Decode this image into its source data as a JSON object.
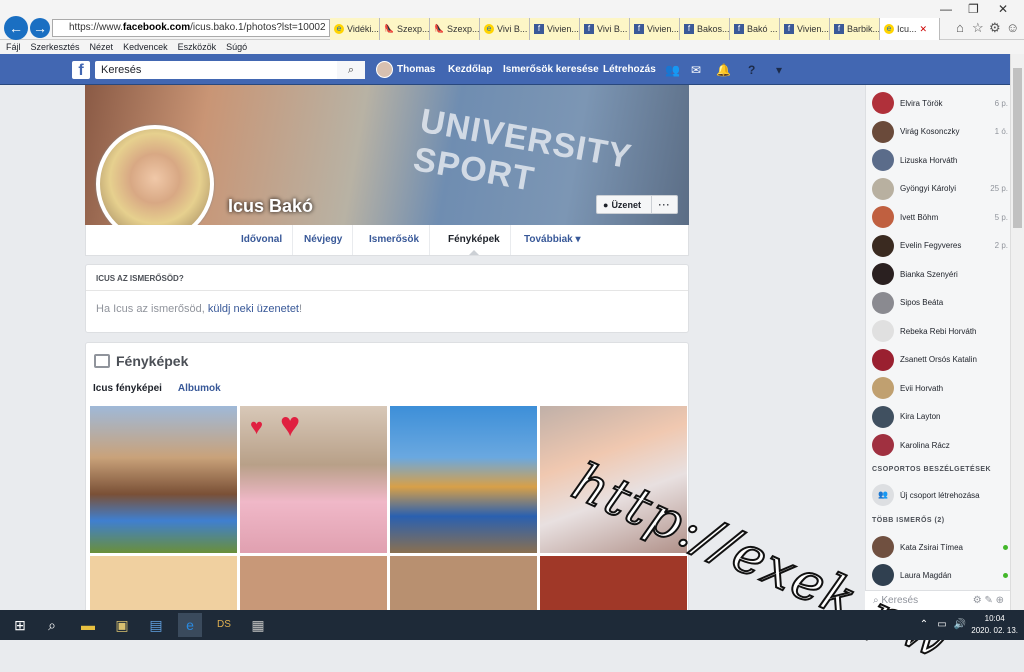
{
  "browser": {
    "url_prefix": "https://www.",
    "url_host": "facebook.com",
    "url_rest": "/icus.bako.1/photos?lst=10002",
    "tabs": [
      {
        "icon": "ie",
        "label": "Vidéki..."
      },
      {
        "icon": "shoe",
        "label": "Szexp..."
      },
      {
        "icon": "shoe",
        "label": "Szexp..."
      },
      {
        "icon": "ie",
        "label": "Vivi B..."
      },
      {
        "icon": "fb",
        "label": "Vivien..."
      },
      {
        "icon": "fb",
        "label": "Vivi B..."
      },
      {
        "icon": "fb",
        "label": "Vivien..."
      },
      {
        "icon": "fb",
        "label": "Bakos..."
      },
      {
        "icon": "fb",
        "label": "Bakó ..."
      },
      {
        "icon": "fb",
        "label": "Vivien..."
      },
      {
        "icon": "fb",
        "label": "Barbik..."
      },
      {
        "icon": "ie",
        "label": "Icu..."
      }
    ],
    "menu": [
      "Fájl",
      "Szerkesztés",
      "Nézet",
      "Kedvencek",
      "Eszközök",
      "Súgó"
    ]
  },
  "fb": {
    "search_placeholder": "Keresés",
    "user": "Thomas",
    "nav": [
      "Kezdőlap",
      "Ismerősök keresése",
      "Létrehozás"
    ]
  },
  "profile": {
    "name": "Icus Bakó",
    "cover_text": "UNIVERSITY SPORT",
    "message_button": "Üzenet",
    "more_button": "···",
    "tabs": [
      "Idővonal",
      "Névjegy",
      "Ismerősök",
      "Fényképek",
      "Továbbiak"
    ]
  },
  "friend_card": {
    "title": "ICUS AZ ISMERŐSÖD?",
    "text_before": "Ha Icus az ismerősöd, ",
    "link": "küldj neki üzenetet",
    "text_after": "!"
  },
  "photos": {
    "title": "Fényképek",
    "tab_active": "Icus fényképei",
    "tab_other": "Albumok"
  },
  "watermark": "http://exek.pw",
  "chat": {
    "contacts": [
      {
        "name": "Elvira Török",
        "time": "6 p.",
        "color": "#b0303a"
      },
      {
        "name": "Virág Kosonczky",
        "time": "1 ó.",
        "color": "#6a4a3a"
      },
      {
        "name": "Lizuska Horváth",
        "time": "",
        "color": "#5b6c8a"
      },
      {
        "name": "Gyöngyi Károlyi",
        "time": "25 p.",
        "color": "#b8b0a0"
      },
      {
        "name": "Ivett Böhm",
        "time": "5 p.",
        "color": "#c06040"
      },
      {
        "name": "Evelin Fegyveres",
        "time": "2 p.",
        "color": "#3a2a20"
      },
      {
        "name": "Bianka Szenyéri",
        "time": "",
        "color": "#2a2020"
      },
      {
        "name": "Sipos Beáta",
        "time": "",
        "color": "#8a8a90"
      },
      {
        "name": "Rebeka Rebi Horváth",
        "time": "",
        "color": "#e0e0e0"
      },
      {
        "name": "Zsanett Orsós Katalin",
        "time": "",
        "color": "#9a2030"
      },
      {
        "name": "Evii Horvath",
        "time": "",
        "color": "#c0a070"
      },
      {
        "name": "Kira Layton",
        "time": "",
        "color": "#405060"
      },
      {
        "name": "Karolina Rácz",
        "time": "",
        "color": "#a03040"
      }
    ],
    "groups_header": "CSOPORTOS BESZÉLGETÉSEK",
    "new_group": "Új csoport létrehozása",
    "more_header": "TÖBB ISMERŐS (2)",
    "more_contacts": [
      {
        "name": "Kata Zsirai Tímea",
        "color": "#705040"
      },
      {
        "name": "Laura Magdán",
        "color": "#304050"
      }
    ],
    "search_placeholder": "Keresés"
  },
  "taskbar": {
    "time": "10:04",
    "date": "2020. 02. 13."
  }
}
